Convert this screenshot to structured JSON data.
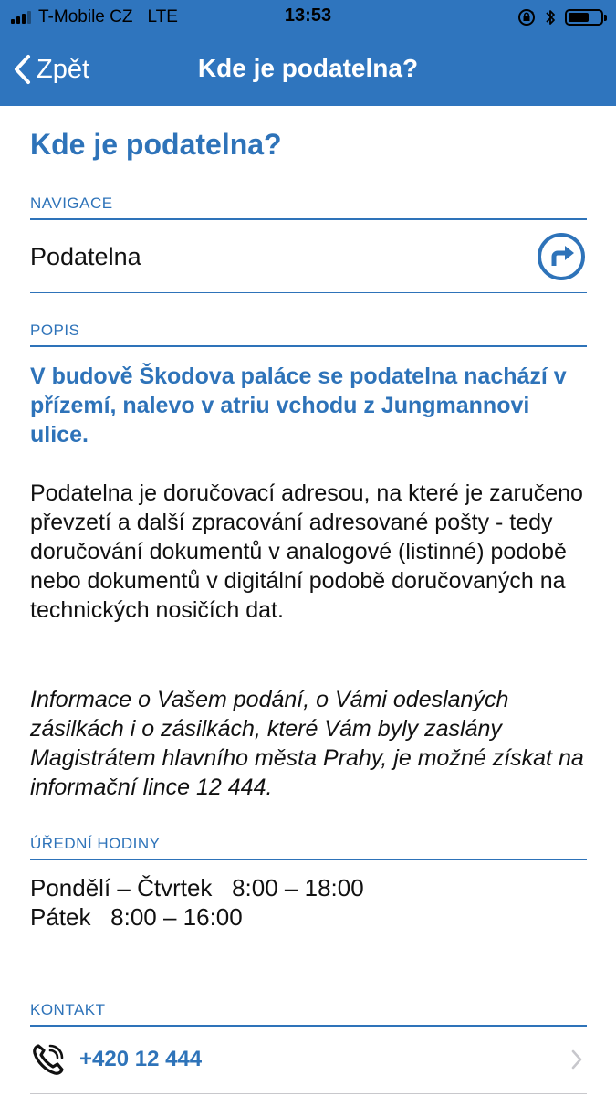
{
  "status_bar": {
    "carrier": "T-Mobile CZ",
    "network": "LTE",
    "time": "13:53",
    "signal_bars_filled": 3,
    "signal_bars_total": 4,
    "battery_level": 0.65,
    "icons": [
      "signal-icon",
      "lock-rotation-icon",
      "bluetooth-icon",
      "battery-icon"
    ]
  },
  "nav": {
    "back_label": "Zpět",
    "title": "Kde je podatelna?"
  },
  "page": {
    "title": "Kde je podatelna?"
  },
  "navigation": {
    "header": "NAVIGACE",
    "item_label": "Podatelna",
    "icon": "directions-icon"
  },
  "description": {
    "header": "POPIS",
    "lead": "V budově Škodova paláce se podatelna nachází v přízemí, nalevo v atriu vchodu z Jungmannovi ulice.",
    "paragraph": " Podatelna je doručovací adresou, na které je zaručeno převzetí a další zpracování adresované pošty - tedy doručování dokumentů v analogové (listinné) podobě nebo dokumentů v digitální podobě doručovaných na technických nosičích dat.",
    "italic_paragraph": " Informace o Vašem podání, o Vámi odeslaných zásilkách i o zásilkách, které Vám byly zaslány Magistrátem hlavního města Prahy, je možné získat na informační lince 12 444."
  },
  "office_hours": {
    "header": "ÚŘEDNÍ HODINY",
    "lines": [
      "Pondělí – Čtvrtek   8:00 – 18:00",
      "Pátek   8:00 – 16:00"
    ]
  },
  "contact": {
    "header": "KONTAKT",
    "phone": "+420 12 444",
    "icon": "phone-icon"
  },
  "colors": {
    "accent": "#2e73b9",
    "bar": "#2f75be",
    "text": "#111111",
    "background": "#ffffff"
  }
}
